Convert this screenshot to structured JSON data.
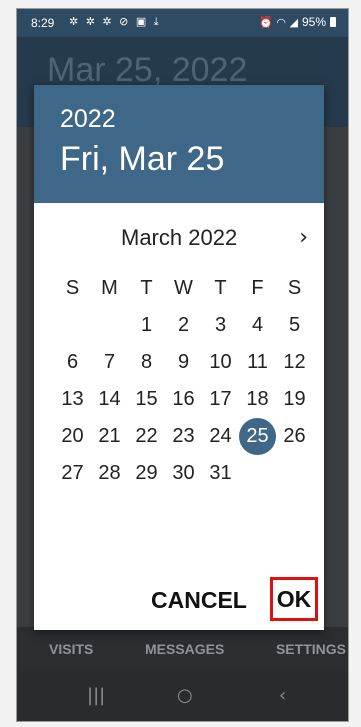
{
  "status_bar": {
    "time": "8:29",
    "left_icons": "✲ ✲ ✲ ⊘ ▣ ⤓",
    "right_icons": "⏰ ◠ ◢",
    "battery_pct": "95%"
  },
  "app": {
    "header_date": "Mar 25, 2022",
    "nav": [
      "VISITS",
      "MESSAGES",
      "SETTINGS"
    ]
  },
  "system_nav": {
    "recents_icon": "|||",
    "home_icon": "○",
    "back_icon": "‹"
  },
  "dialog": {
    "year": "2022",
    "selected_date": "Fri, Mar 25",
    "month_label": "March 2022",
    "next_icon": "›",
    "weekdays": [
      "S",
      "M",
      "T",
      "W",
      "T",
      "F",
      "S"
    ],
    "days": [
      "",
      "",
      "1",
      "2",
      "3",
      "4",
      "5",
      "6",
      "7",
      "8",
      "9",
      "10",
      "11",
      "12",
      "13",
      "14",
      "15",
      "16",
      "17",
      "18",
      "19",
      "20",
      "21",
      "22",
      "23",
      "24",
      "25",
      "26",
      "27",
      "28",
      "29",
      "30",
      "31",
      "",
      ""
    ],
    "selected_day": "25",
    "cancel_label": "CANCEL",
    "ok_label": "OK"
  },
  "colors": {
    "header_blue": "#3e6788",
    "highlight_red": "#e01010"
  }
}
